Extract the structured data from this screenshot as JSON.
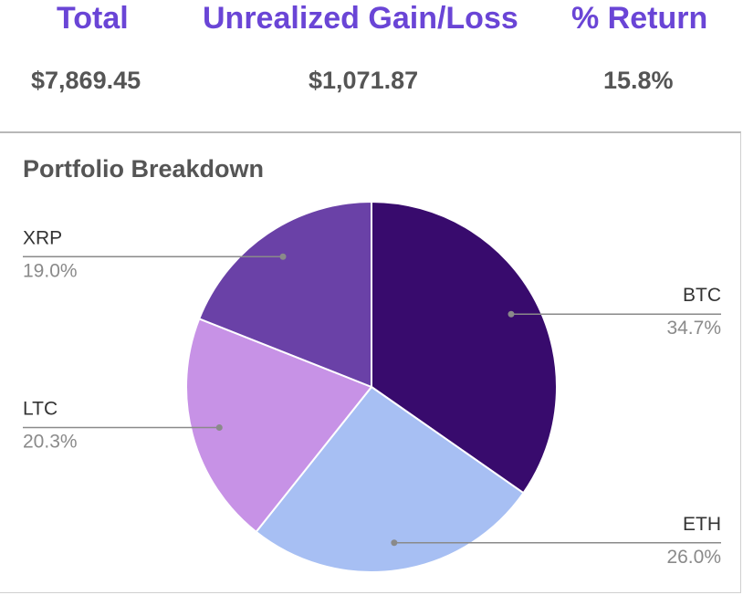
{
  "summary": {
    "header_color": "#6a45d6",
    "total_label": "Total",
    "gain_label": "Unrealized Gain/Loss",
    "return_label": "% Return",
    "total_value": "$7,869.45",
    "gain_value": "$1,071.87",
    "return_value": "15.8%"
  },
  "chart_data": {
    "type": "pie",
    "title": "Portfolio Breakdown",
    "legend": "none (slice labels with leader lines)",
    "slices": [
      {
        "label": "BTC",
        "value": 34.7,
        "display": "34.7%",
        "color": "#380b6d",
        "side": "right"
      },
      {
        "label": "ETH",
        "value": 26.0,
        "display": "26.0%",
        "color": "#a7bff3",
        "side": "right"
      },
      {
        "label": "LTC",
        "value": 20.3,
        "display": "20.3%",
        "color": "#c792e6",
        "side": "left"
      },
      {
        "label": "XRP",
        "value": 19.0,
        "display": "19.0%",
        "color": "#6a41a7",
        "side": "left"
      }
    ]
  }
}
